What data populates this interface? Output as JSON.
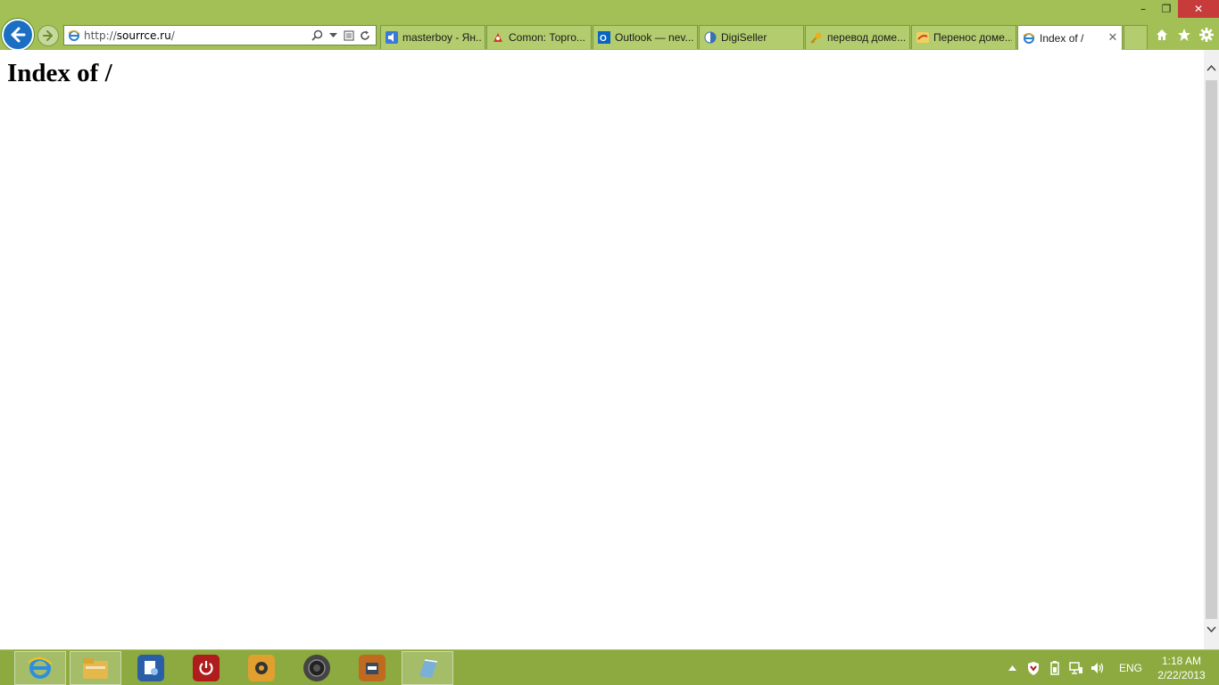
{
  "browser": {
    "address_url_prefix": "http://",
    "address_url_domain": "sourrce.ru",
    "address_url_suffix": "/",
    "tabs": [
      {
        "label": "masterboy - Ян...",
        "icon": "speaker-icon",
        "active": false
      },
      {
        "label": "Comon: Торго...",
        "icon": "rocket-icon",
        "active": false
      },
      {
        "label": "Outlook — nev...",
        "icon": "outlook-icon",
        "active": false
      },
      {
        "label": "DigiSeller",
        "icon": "half-circle-icon",
        "active": false
      },
      {
        "label": "перевод доме...",
        "icon": "key-icon",
        "active": false
      },
      {
        "label": "Перенос доме...",
        "icon": "site-icon",
        "active": false
      },
      {
        "label": "Index of /",
        "icon": "ie-icon",
        "active": true
      }
    ],
    "tab_close_glyph": "✕",
    "window_controls": {
      "minimize": "–",
      "restore": "❐",
      "close": "✕"
    }
  },
  "page": {
    "heading": "Index of /"
  },
  "taskbar": {
    "apps": [
      {
        "name": "internet-explorer",
        "color": "#1a6fc4"
      },
      {
        "name": "file-explorer",
        "color": "#e6b84a"
      },
      {
        "name": "settings-app",
        "color": "#2a5fa8"
      },
      {
        "name": "power-app",
        "color": "#b01c1c"
      },
      {
        "name": "media-app",
        "color": "#e0a030"
      },
      {
        "name": "speaker-app",
        "color": "#444444"
      },
      {
        "name": "doc-app",
        "color": "#c06a20"
      },
      {
        "name": "notes-app",
        "color": "#7ab0d8"
      }
    ],
    "tray": {
      "language": "ENG",
      "time": "1:18 AM",
      "date": "2/22/2013"
    }
  },
  "colors": {
    "chrome_bg": "#a2c055",
    "taskbar_bg": "#8caa3f",
    "back_button": "#1a6fc4",
    "close_button": "#c73b3b"
  }
}
